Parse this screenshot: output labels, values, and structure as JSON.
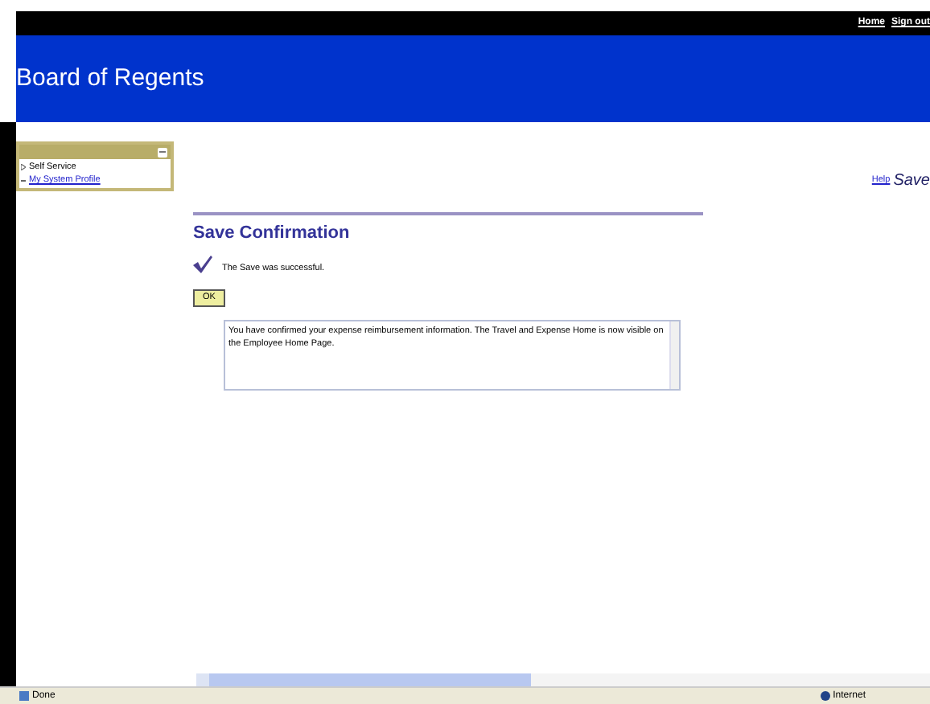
{
  "header": {
    "links": [
      "Home",
      "Sign out"
    ],
    "title": "Board of Regents"
  },
  "menu": {
    "items": [
      {
        "label": "Self Service",
        "kind": "folder"
      },
      {
        "label": "My System Profile",
        "kind": "link"
      }
    ]
  },
  "page_links": {
    "help": "Help",
    "page_title": "Save"
  },
  "confirmation": {
    "title": "Save Confirmation",
    "message": "The Save was successful.",
    "button": "OK",
    "details": "You have confirmed your expense reimbursement information.  The Travel and Expense Home is now visible on the Employee Home Page."
  },
  "status_bar": {
    "status": "Done",
    "zone": "Internet"
  }
}
